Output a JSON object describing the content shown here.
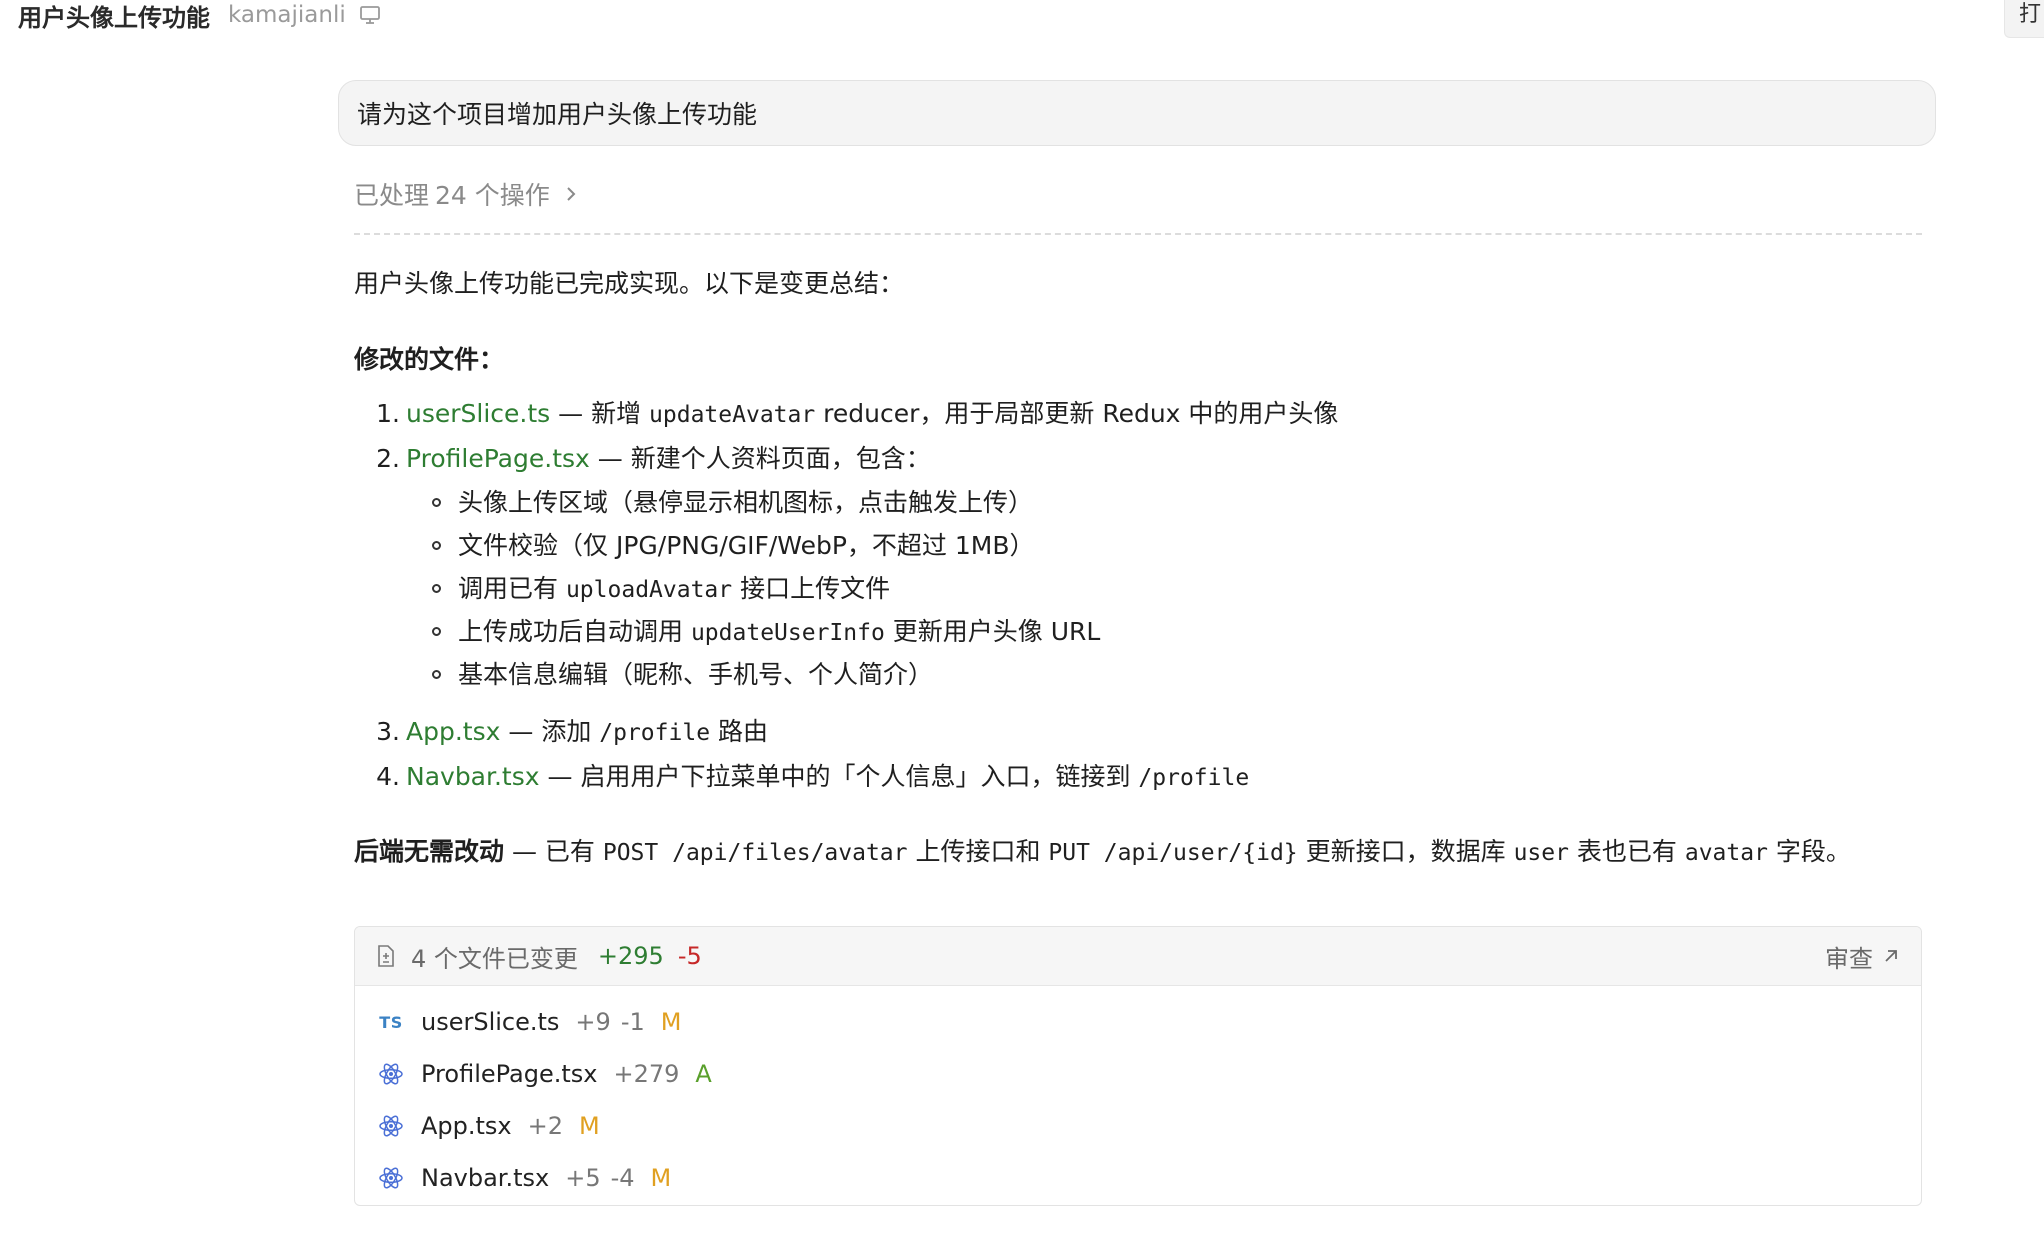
{
  "header": {
    "title": "用户头像上传功能",
    "repo": "kamajianli",
    "right_button_label": "打"
  },
  "prompt": {
    "text": "请为这个项目增加用户头像上传功能"
  },
  "processed": {
    "prefix": "已处理",
    "count": "24 个操作"
  },
  "summary": "用户头像上传功能已完成实现。以下是变更总结：",
  "modified_title": "修改的文件：",
  "files_list": [
    {
      "num": "1.",
      "name": "userSlice.ts",
      "dash": " — 新增 ",
      "code": "updateAvatar",
      "rest": " reducer，用于局部更新 Redux 中的用户头像"
    },
    {
      "num": "2.",
      "name": "ProfilePage.tsx",
      "dash": " — 新建个人资料页面，包含：",
      "subitems": {
        "s1": "头像上传区域（悬停显示相机图标，点击触发上传）",
        "s2": "文件校验（仅 JPG/PNG/GIF/WebP，不超过 1MB）",
        "s3_pre": "调用已有 ",
        "s3_code": "uploadAvatar",
        "s3_post": " 接口上传文件",
        "s4_pre": "上传成功后自动调用 ",
        "s4_code": "updateUserInfo",
        "s4_post": " 更新用户头像 URL",
        "s5": "基本信息编辑（昵称、手机号、个人简介）"
      }
    },
    {
      "num": "3.",
      "name": "App.tsx",
      "dash": " — 添加 ",
      "code": "/profile",
      "rest": " 路由"
    },
    {
      "num": "4.",
      "name": "Navbar.tsx",
      "dash": " — 启用用户下拉菜单中的「个人信息」入口，链接到 ",
      "code": "/profile",
      "rest": ""
    }
  ],
  "backend": {
    "bold": "后端无需改动",
    "t1": " — 已有 ",
    "c1": "POST /api/files/avatar",
    "t2": " 上传接口和 ",
    "c2": "PUT /api/user/{id}",
    "t3": " 更新接口，数据库 ",
    "c3": "user",
    "t4": " 表也已有 ",
    "c4": "avatar",
    "t5": " 字段。"
  },
  "changes_card": {
    "summary": "4 个文件已变更",
    "additions": "+295",
    "deletions": "-5",
    "review_label": "审查",
    "files": [
      {
        "icon": "typescript-icon",
        "badge": "TS",
        "name": "userSlice.ts",
        "adds": "+9",
        "dels": "-1",
        "status": "M"
      },
      {
        "icon": "react-icon",
        "name": "ProfilePage.tsx",
        "adds": "+279",
        "dels": "",
        "status": "A"
      },
      {
        "icon": "react-icon",
        "name": "App.tsx",
        "adds": "+2",
        "dels": "",
        "status": "M"
      },
      {
        "icon": "react-icon",
        "name": "Navbar.tsx",
        "adds": "+5",
        "dels": "-4",
        "status": "M"
      }
    ]
  },
  "colors": {
    "link_green": "#2e7d32",
    "addition_green": "#2e7d32",
    "deletion_red": "#c62828",
    "modified_orange": "#e0a021",
    "added_green": "#5aa02c",
    "ts_blue": "#3b82c4",
    "react_blue": "#4a6fd6"
  }
}
